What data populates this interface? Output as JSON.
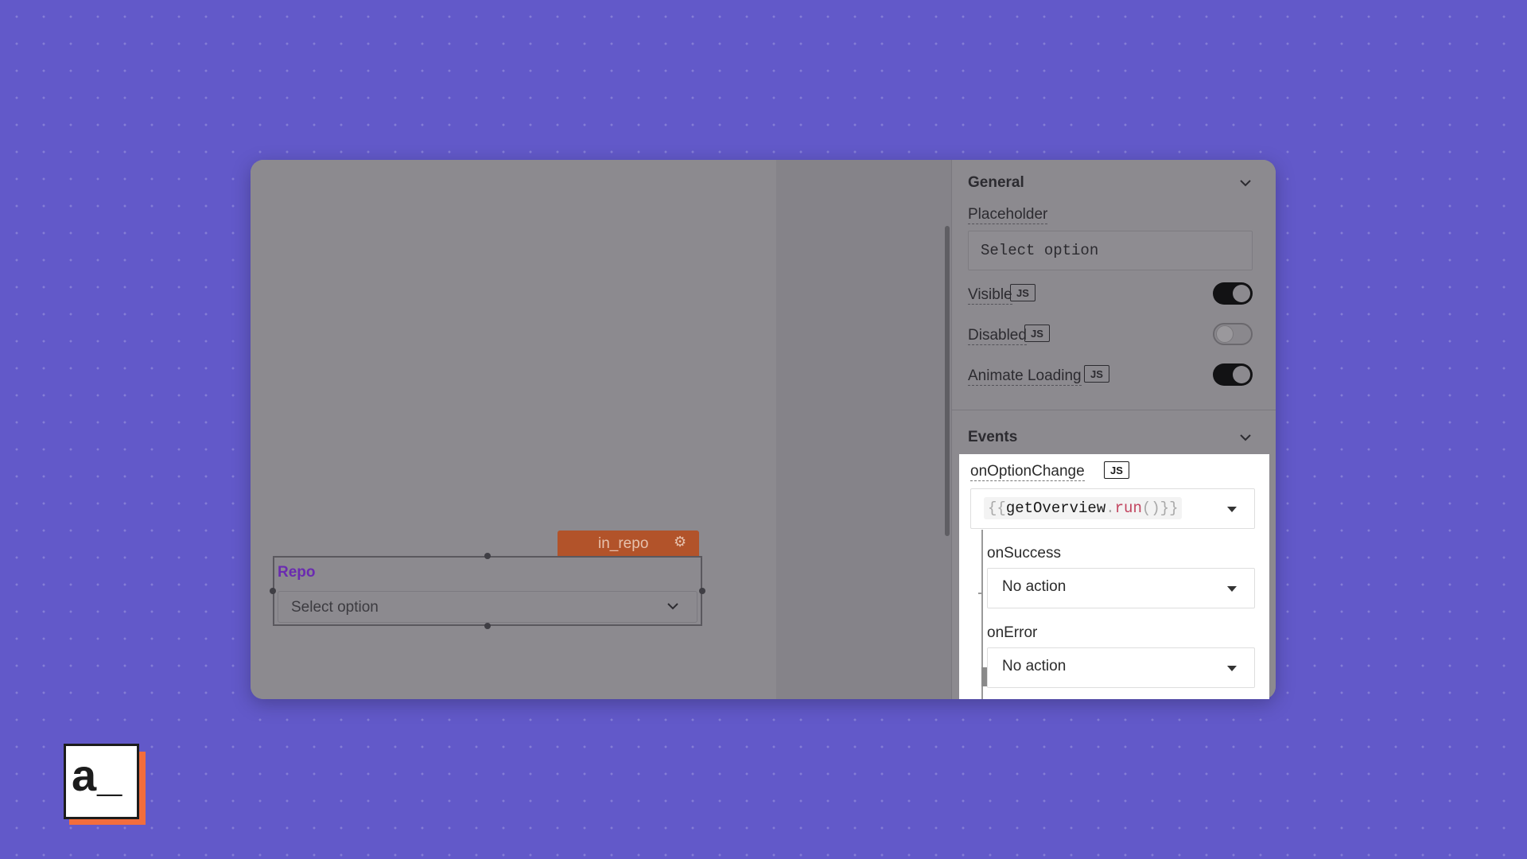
{
  "canvas": {
    "widget_tag": "in_repo",
    "widget_tag_icon": "gear-icon",
    "widget_label": "Repo",
    "widget_placeholder": "Select option",
    "widget_chevron_icon": "chevron-down-icon"
  },
  "general": {
    "title": "General",
    "placeholder_label": "Placeholder",
    "placeholder_value": "Select option",
    "visible_label": "Visible",
    "visible_on": true,
    "disabled_label": "Disabled",
    "disabled_on": false,
    "animate_label": "Animate Loading",
    "animate_on": true,
    "js_badge": "JS"
  },
  "events": {
    "title": "Events",
    "option_change_label": "onOptionChange",
    "js_badge": "JS",
    "code": {
      "open": "{{",
      "ident": "getOverview",
      "dot": ".",
      "fn": "run",
      "close": "()}}"
    },
    "on_success_label": "onSuccess",
    "on_success_value": "No action",
    "on_error_label": "onError",
    "on_error_value": "No action"
  },
  "logo": {
    "text": "a_"
  },
  "colors": {
    "background": "#6259c9",
    "accent_orange": "#f26d3c",
    "widget_label": "#6a2bb0",
    "code_fn": "#c2435e"
  }
}
